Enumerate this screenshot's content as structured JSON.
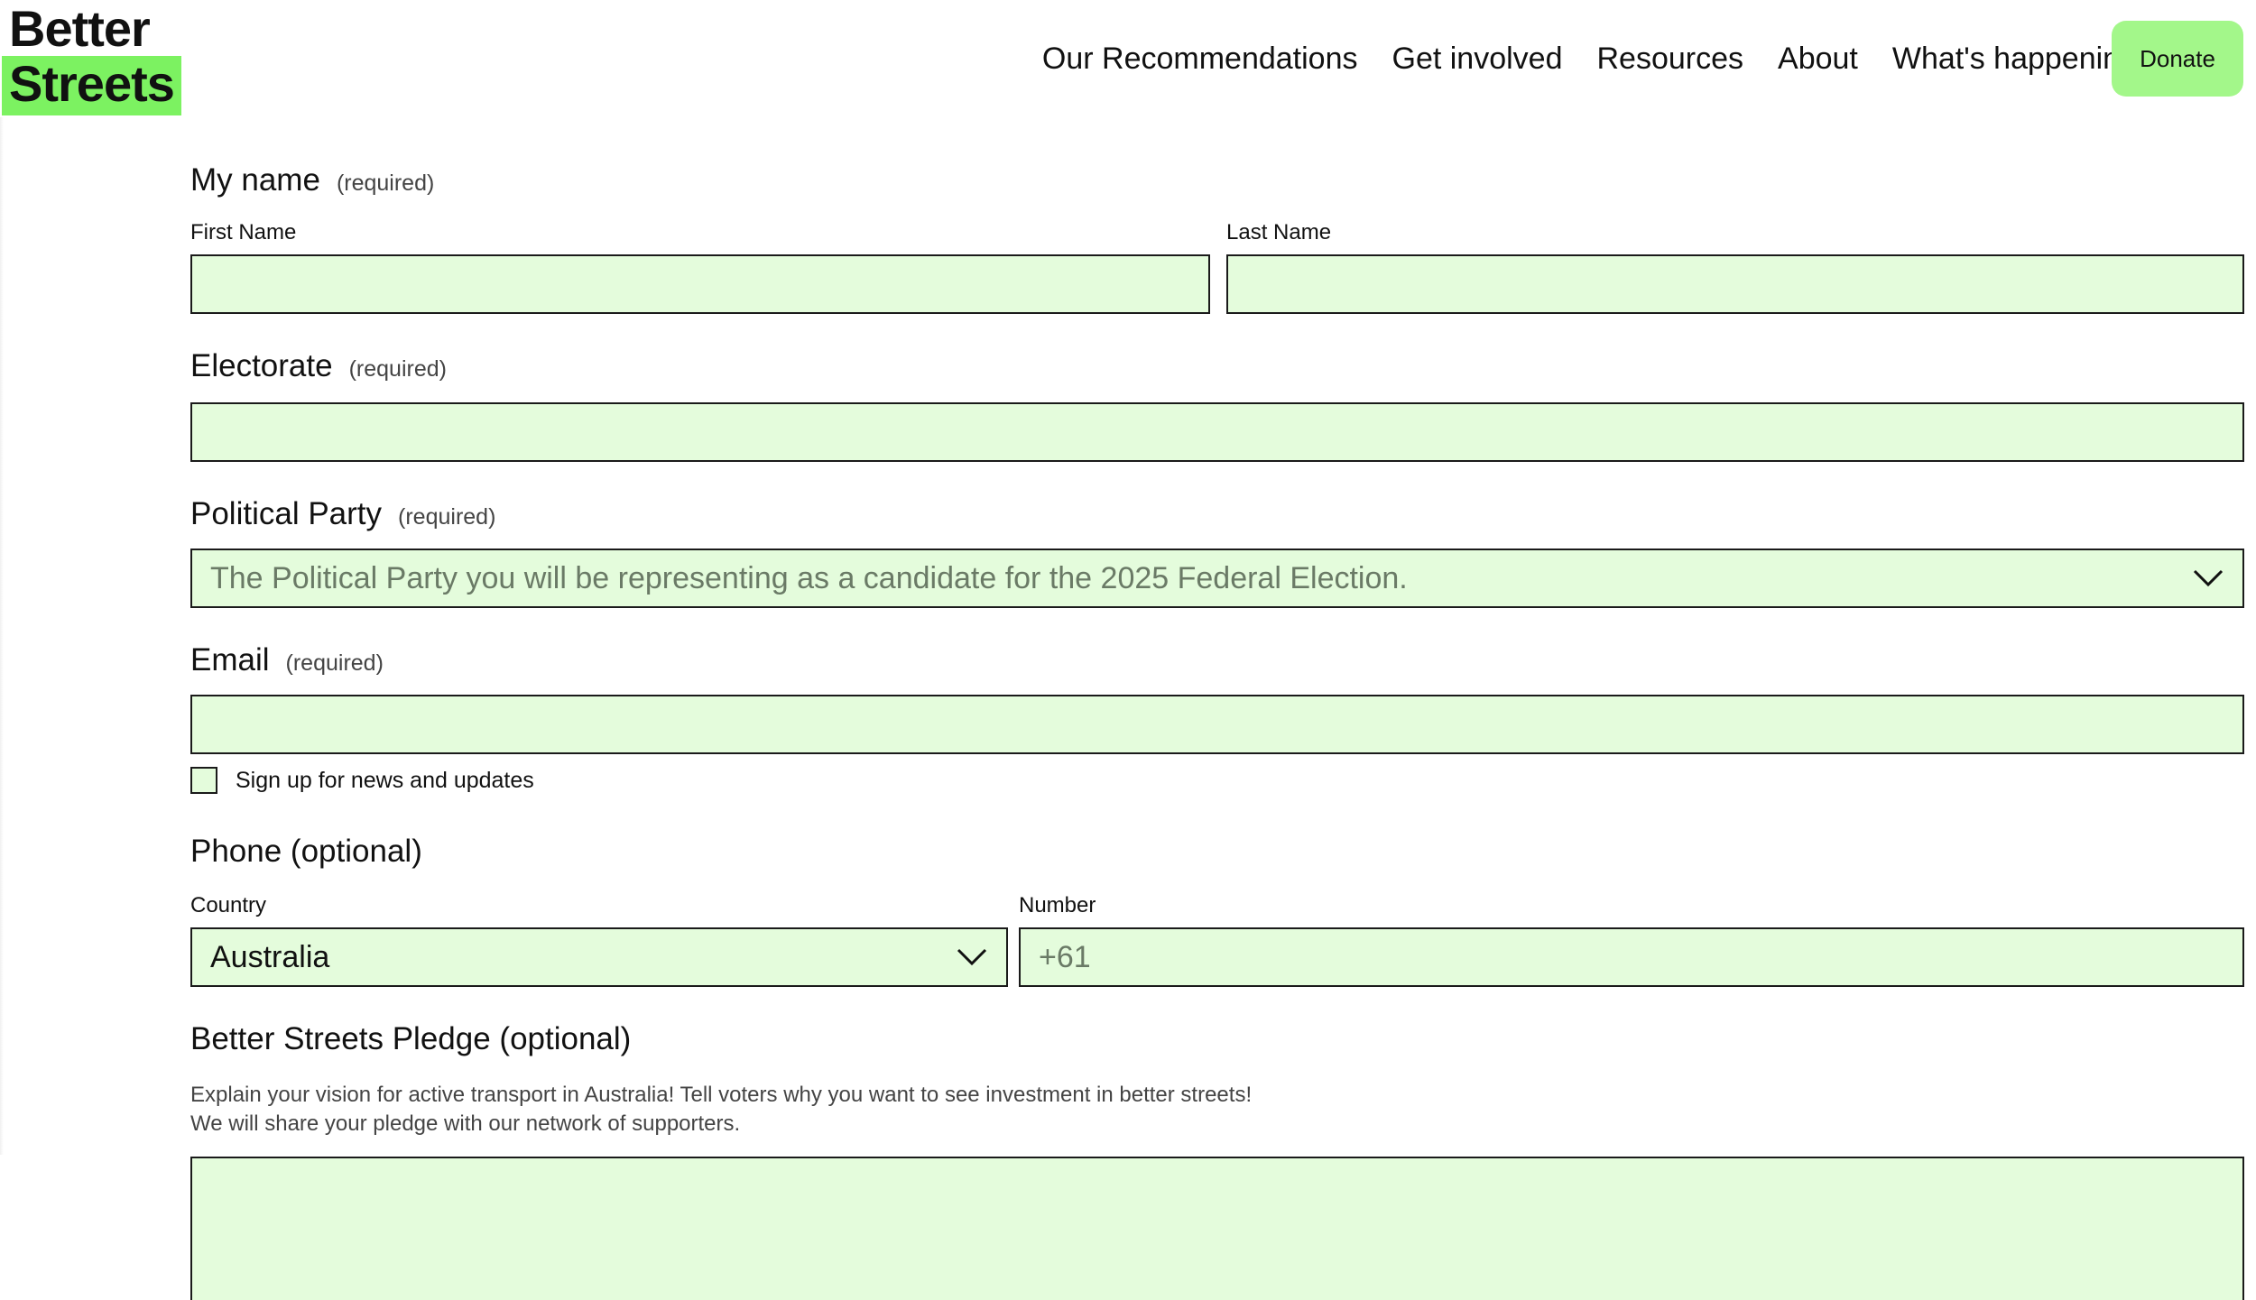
{
  "header": {
    "logo_line1": "Better",
    "logo_line2": "Streets",
    "nav": [
      {
        "label": "Our Recommendations"
      },
      {
        "label": "Get involved"
      },
      {
        "label": "Resources"
      },
      {
        "label": "About"
      },
      {
        "label": "What's happening"
      }
    ],
    "donate_label": "Donate",
    "accent_color": "#7cf261",
    "button_color": "#a3f78a"
  },
  "form": {
    "field_bg_color": "#e4fcdc",
    "required_text": "(required)",
    "name": {
      "title": "My name",
      "first_label": "First Name",
      "first_value": "",
      "last_label": "Last Name",
      "last_value": ""
    },
    "electorate": {
      "title": "Electorate",
      "value": ""
    },
    "party": {
      "title": "Political Party",
      "placeholder": "The Political Party you will be representing as a candidate for the 2025 Federal Election.",
      "icon": "chevron-down-icon"
    },
    "email": {
      "title": "Email",
      "value": "",
      "newsletter_label": "Sign up for news and updates",
      "newsletter_checked": false
    },
    "phone": {
      "title": "Phone (optional)",
      "country_label": "Country",
      "country_value": "Australia",
      "number_label": "Number",
      "number_placeholder": "+61"
    },
    "pledge": {
      "title": "Better Streets Pledge (optional)",
      "desc_line1": "Explain your vision for active transport in Australia! Tell voters why you want to see investment in better streets!",
      "desc_line2": "We will share your pledge with our network of supporters.",
      "value": ""
    }
  }
}
